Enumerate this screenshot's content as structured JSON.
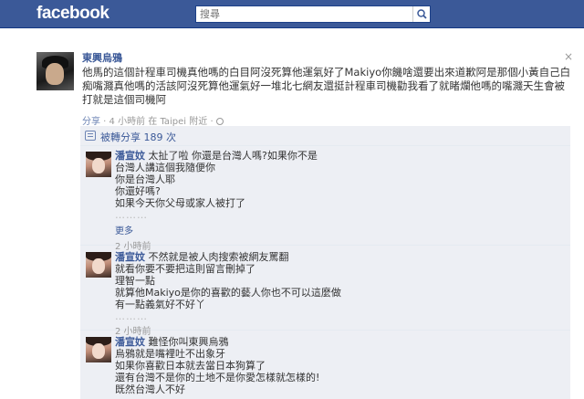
{
  "header": {
    "logo": "facebook",
    "search_placeholder": "搜尋"
  },
  "post": {
    "author": "東興烏鴉",
    "text": "他馬的這個計程車司機真他嗎的白目阿沒死算他運氣好了Makiyo你饑啥還要出來道歉阿是那個小黃自己白痴嘴濺真他嗎的活該阿沒死算他運氣好一堆北七網友還挺計程車司機勸我看了就睹爛他嗎的嘴濺天生會被打就是這個司機阿",
    "meta": {
      "share": "分享",
      "sep1": " · ",
      "time": "4 小時前 在 Taipei 附近",
      "sep2": " · "
    },
    "close": "×"
  },
  "shared": {
    "count_label": "被轉分享 189 次"
  },
  "comments": [
    {
      "name": "潘宣妏",
      "first_line": "太扯了啦 你還是台灣人嗎?如果你不是",
      "lines": [
        "台灣人講這個我隨便你",
        "你是台灣人耶",
        "你還好嗎?",
        "如果今天你父母或家人被打了"
      ],
      "dots": "………",
      "more": "更多",
      "time": "2 小時前"
    },
    {
      "name": "潘宣妏",
      "first_line": "不然就是被人肉搜索被網友罵翻",
      "lines": [
        "就看你要不要把這則留言刪掉了",
        "理智一點",
        "就算他Makiyo是你的喜歡的藝人你也不可以這麼做",
        "有一點義氣好不好丫"
      ],
      "dots": "………",
      "time": "2 小時前"
    },
    {
      "name": "潘宣妏",
      "first_line": "難怪你叫東興烏鴉",
      "lines": [
        "烏鴉就是嘴裡吐不出象牙",
        "如果你喜歡日本就去當日本狗算了",
        "還有台灣不是你的土地不是你愛怎樣就怎樣的!",
        "既然台灣人不好"
      ]
    }
  ]
}
